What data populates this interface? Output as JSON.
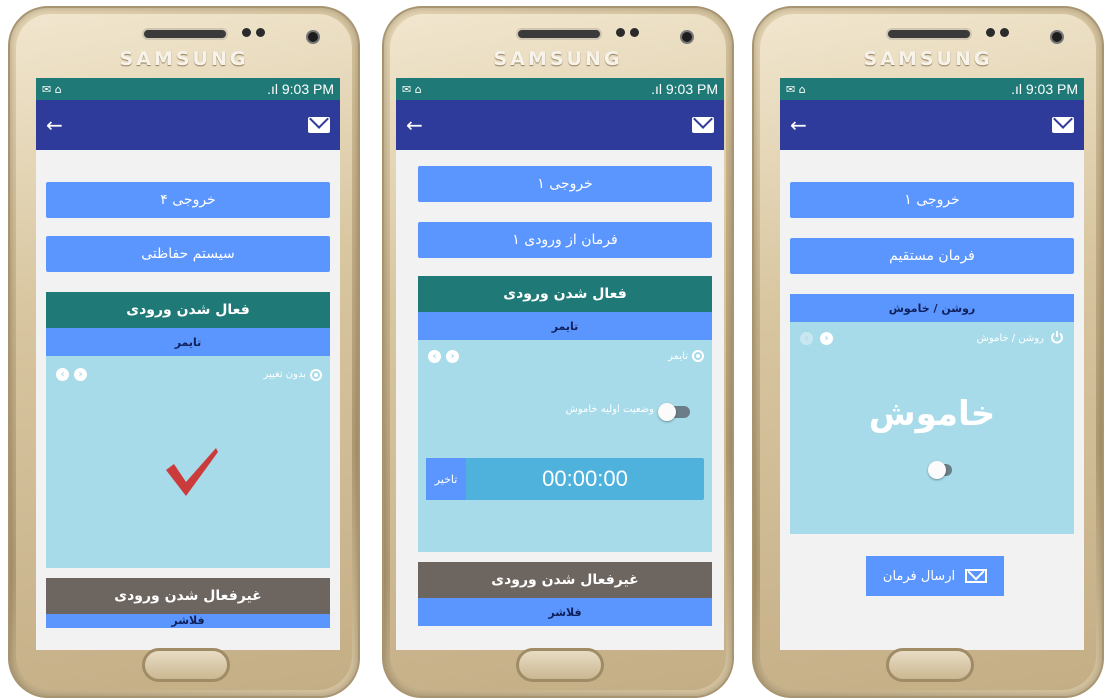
{
  "status_time": "9:03 PM",
  "brand": "SAMSUNG",
  "screen1": {
    "output_btn": "خروجی ۴",
    "mode_btn": "سیستم حفاظتی",
    "active_header": "فعال شدن ورودی",
    "active_sub": "تایمر",
    "no_change_label": "بدون تغییر",
    "inactive_header": "غیرفعال شدن ورودی",
    "inactive_sub_partial": "فلاشر"
  },
  "screen2": {
    "output_btn": "خروجی ۱",
    "mode_btn": "فرمان از ورودی ۱",
    "active_header": "فعال شدن ورودی",
    "active_sub": "تایمر",
    "timer_label": "تایمر",
    "initial_state_label": "وضعیت اولیه خاموش",
    "delay_label": "تاخیر",
    "time_value": "00:00:00",
    "inactive_header": "غیرفعال شدن ورودی",
    "inactive_sub": "فلاشر"
  },
  "screen3": {
    "output_btn": "خروجی ۱",
    "mode_btn": "فرمان مستقیم",
    "sub_header": "روشن / خاموش",
    "onoff_label": "روشن / خاموش",
    "state_text": "خاموش",
    "send_btn": "ارسال فرمان"
  },
  "colors": {
    "appbar": "#2f3b9a",
    "statusbar": "#1f7a77",
    "primary": "#5b96ff",
    "panel": "#a7dbe9",
    "inactive_header": "#6d6560",
    "check": "#cc3b3b"
  }
}
